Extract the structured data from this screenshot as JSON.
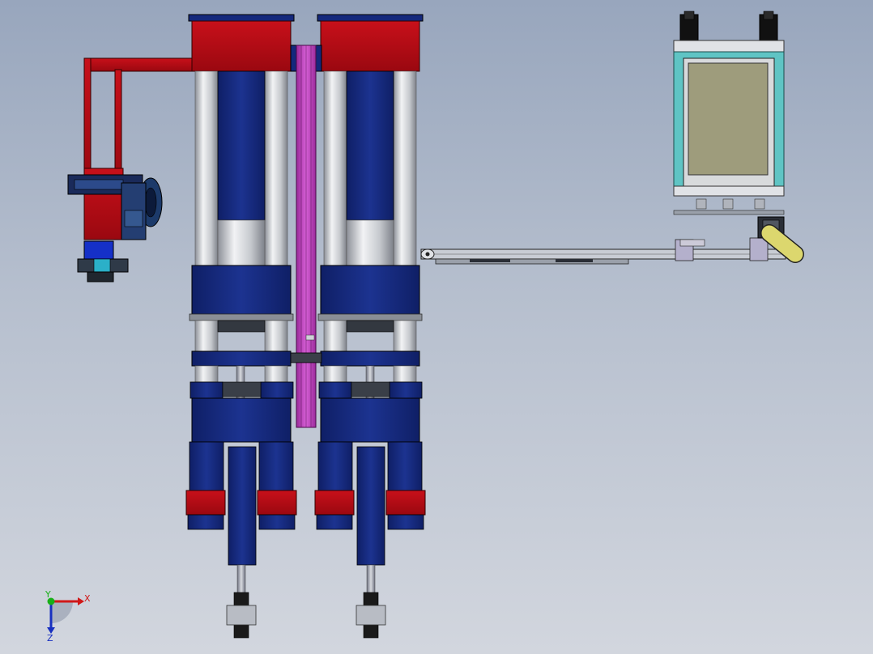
{
  "viewport": {
    "background_top": "#98a6bd",
    "background_bottom": "#d2d6de"
  },
  "colors": {
    "frame_red": "#b30a0e",
    "cylinder_blue": "#14287c",
    "rod_silver": "#c9ccd1",
    "belt_magenta": "#c04cc0",
    "cabinet_teal": "#5fc4c4",
    "panel_olive": "#9e9c7c",
    "arm_yellow": "#dcd76e"
  },
  "triad": {
    "x_label": "X",
    "y_label": "Y",
    "z_label": "Z",
    "x_color": "#d01818",
    "y_color": "#18b018",
    "z_color": "#1830c0"
  }
}
